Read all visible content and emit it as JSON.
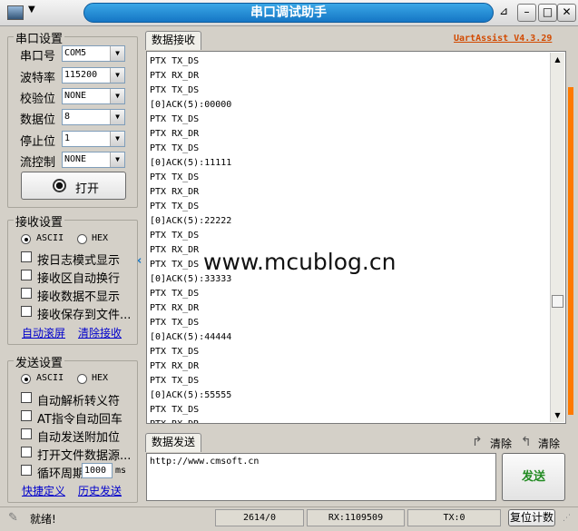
{
  "window": {
    "title": "串口调试助手",
    "controls": {
      "minimize": "–",
      "maximize": "□",
      "close": "✕"
    }
  },
  "brand": {
    "version": "UartAssist V4.3.29",
    "color": "#d24a00"
  },
  "serial_settings": {
    "title": "串口设置",
    "fields": [
      {
        "label": "串口号",
        "value": "COM5"
      },
      {
        "label": "波特率",
        "value": "115200"
      },
      {
        "label": "校验位",
        "value": "NONE"
      },
      {
        "label": "数据位",
        "value": "8"
      },
      {
        "label": "停止位",
        "value": "1"
      },
      {
        "label": "流控制",
        "value": "NONE"
      }
    ],
    "open_button": "打开"
  },
  "receive_settings": {
    "title": "接收设置",
    "modes": [
      {
        "label": "ASCII",
        "selected": true
      },
      {
        "label": "HEX",
        "selected": false
      }
    ],
    "options": [
      "按日志模式显示",
      "接收区自动换行",
      "接收数据不显示",
      "接收保存到文件..."
    ],
    "links": {
      "auto_scroll": "自动滚屏",
      "clear": "清除接收"
    }
  },
  "send_settings": {
    "title": "发送设置",
    "modes": [
      {
        "label": "ASCII",
        "selected": true
      },
      {
        "label": "HEX",
        "selected": false
      }
    ],
    "options": [
      "自动解析转义符",
      "AT指令自动回车",
      "自动发送附加位",
      "打开文件数据源..."
    ],
    "cycle": {
      "label": "循环周期",
      "value": "1000",
      "unit": "ms"
    },
    "links": {
      "shortcuts": "快捷定义",
      "history": "历史发送"
    }
  },
  "receive_panel": {
    "tab": "数据接收",
    "lines": [
      "PTX TX_DS",
      "PTX RX_DR",
      "PTX TX_DS",
      "[0]ACK(5):00000",
      "PTX TX_DS",
      "PTX RX_DR",
      "PTX TX_DS",
      "[0]ACK(5):11111",
      "PTX TX_DS",
      "PTX RX_DR",
      "PTX TX_DS",
      "[0]ACK(5):22222",
      "PTX TX_DS",
      "PTX RX_DR",
      "PTX TX_DS",
      "[0]ACK(5):33333",
      "PTX TX_DS",
      "PTX RX_DR",
      "PTX TX_DS",
      "[0]ACK(5):44444",
      "PTX TX_DS",
      "PTX RX_DR",
      "PTX TX_DS",
      "[0]ACK(5):55555",
      "PTX TX_DS",
      "PTX RX_DR"
    ],
    "watermark": "www.mcublog.cn"
  },
  "send_panel": {
    "tab": "数据发送",
    "clear1": "清除",
    "clear2": "清除",
    "text": "http://www.cmsoft.cn",
    "send_button": "发送"
  },
  "status_bar": {
    "ready": "就绪!",
    "counter": "2614/0",
    "rx": "RX:1109509",
    "tx": "TX:0",
    "reset": "复位计数"
  }
}
